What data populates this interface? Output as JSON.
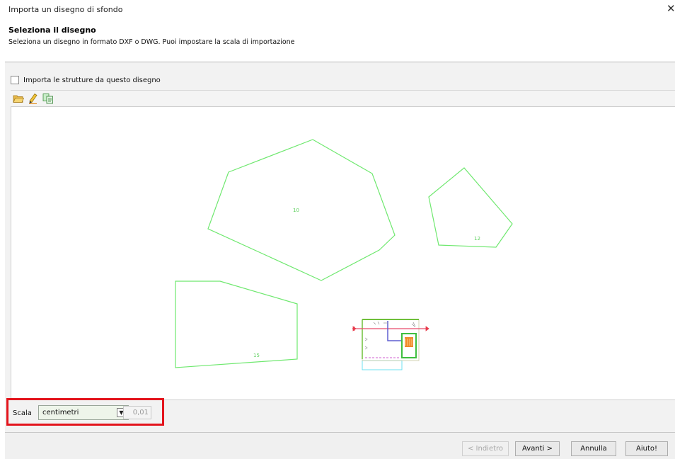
{
  "window": {
    "title": "Importa un disegno di sfondo",
    "close_glyph": "✕"
  },
  "header": {
    "title": "Seleziona il disegno",
    "subtitle": "Seleziona un disegno in formato DXF o DWG. Puoi impostare la scala di importazione"
  },
  "import_option": {
    "label": "Importa le strutture da questo disegno",
    "checked": false
  },
  "toolbar": {
    "icons": [
      "folder-open-icon",
      "pencil-icon",
      "copy-icon"
    ]
  },
  "drawing": {
    "line_color": "#6fe86f",
    "shape_labels": [
      "10",
      "12",
      "15"
    ]
  },
  "scale": {
    "label": "Scala",
    "unit": "centimetri",
    "value": "0,01"
  },
  "buttons": {
    "back": "< Indietro",
    "next": "Avanti >",
    "cancel": "Annulla",
    "help": "Aiuto!"
  },
  "colors": {
    "highlight": "#e3141c"
  }
}
